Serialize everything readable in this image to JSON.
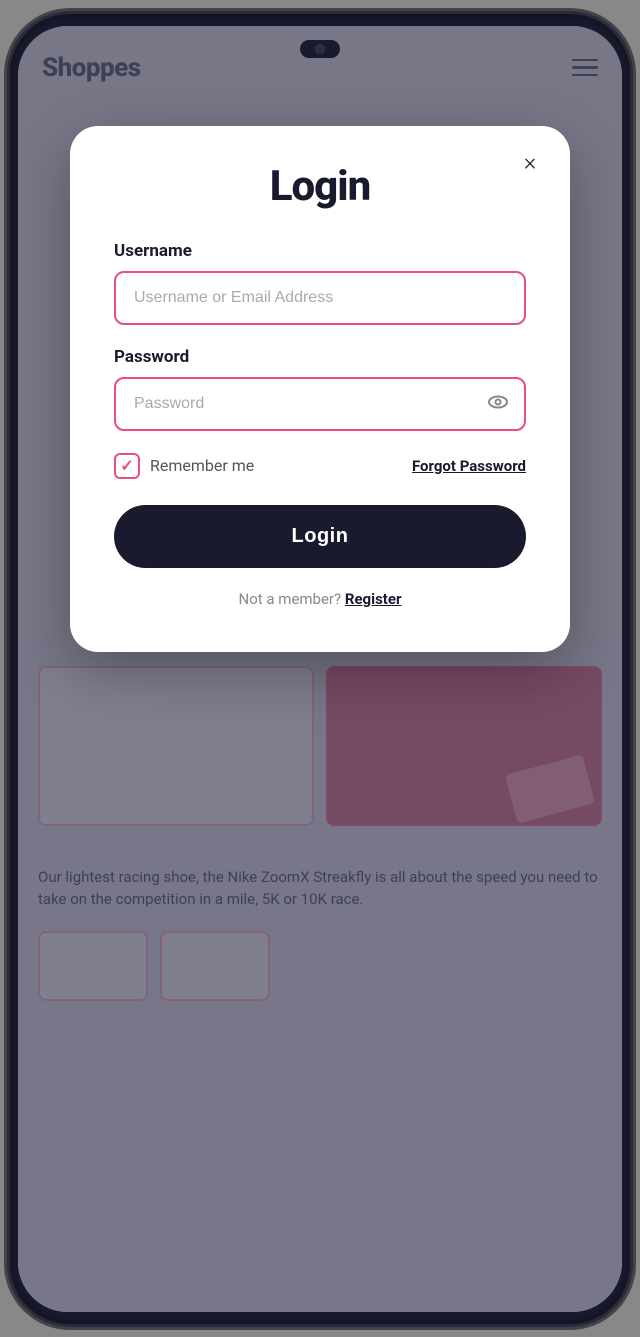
{
  "phone": {
    "notch_label": "camera"
  },
  "header": {
    "logo": "Shoppes",
    "menu_icon": "menu"
  },
  "background": {
    "product_text": "Our lightest racing shoe, the Nike ZoomX Streakfly is all about the speed you need to take on the competition in a mile, 5K or 10K race."
  },
  "modal": {
    "title": "Login",
    "close_label": "×",
    "username_label": "Username",
    "username_placeholder": "Username or Email Address",
    "password_label": "Password",
    "password_placeholder": "Password",
    "remember_label": "Remember me",
    "forgot_label": "Forgot Password",
    "login_button": "Login",
    "register_prompt": "Not a member?",
    "register_link": "Register"
  }
}
